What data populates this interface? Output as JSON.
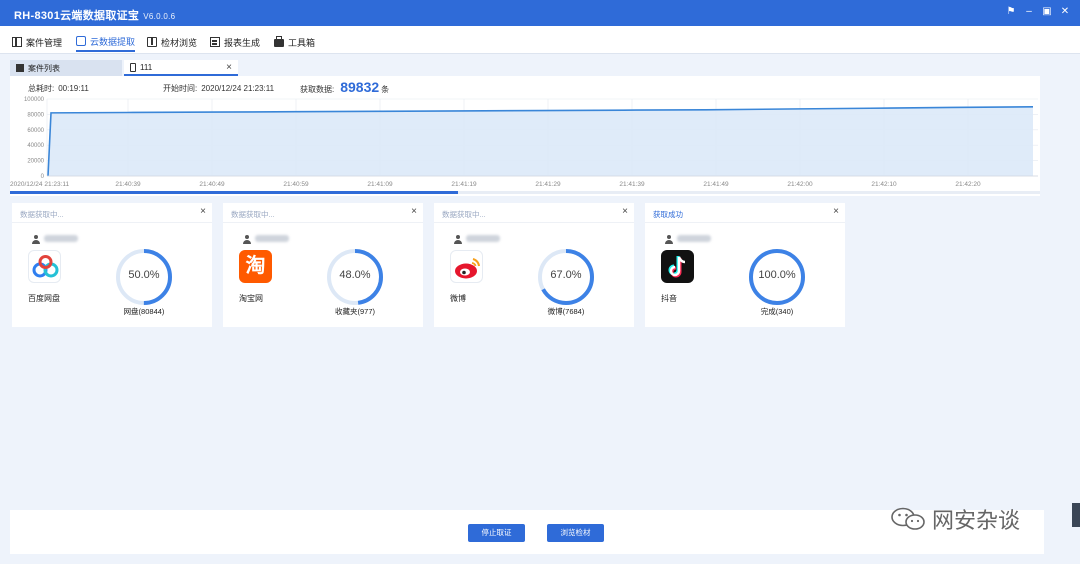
{
  "window": {
    "title": "RH-8301云端数据取证宝",
    "version": "V6.0.0.6",
    "controls": [
      "⚑",
      "–",
      "▣",
      "✕"
    ]
  },
  "menu": {
    "items": [
      {
        "label": "案件管理",
        "icon": "grid-icon",
        "active": false
      },
      {
        "label": "云数据提取",
        "icon": "cloud-icon",
        "active": true
      },
      {
        "label": "检材浏览",
        "icon": "book-icon",
        "active": false
      },
      {
        "label": "报表生成",
        "icon": "report-icon",
        "active": false
      },
      {
        "label": "工具箱",
        "icon": "toolbox-icon",
        "active": false
      }
    ]
  },
  "tabs": [
    {
      "label": "案件列表",
      "icon": "list-icon"
    },
    {
      "label": "111",
      "icon": "phone-icon",
      "close": "×"
    }
  ],
  "stats": {
    "elapsed_label": "总耗时:",
    "elapsed_value": "00:19:11",
    "start_label": "开始时间:",
    "start_value": "2020/12/24 21:23:11",
    "count_label": "获取数据:",
    "count_value": "89832",
    "count_unit": "条"
  },
  "progress": 0.435,
  "chart_data": {
    "type": "area",
    "x": [
      "2020/12/24 21:23:11",
      "21:23:12",
      "21:40:39",
      "21:40:49",
      "21:40:59",
      "21:41:09",
      "21:41:19",
      "21:41:29",
      "21:41:39",
      "21:41:49",
      "21:42:00",
      "21:42:10",
      "21:42:20",
      "21:42:29"
    ],
    "y": [
      0,
      82000,
      82500,
      83000,
      83500,
      84000,
      84500,
      85000,
      85500,
      86000,
      87000,
      88000,
      89000,
      89832
    ],
    "xtick_labels": [
      "2020/12/24 21:23:11",
      "21:40:39",
      "21:40:49",
      "21:40:59",
      "21:41:09",
      "21:41:19",
      "21:41:29",
      "21:41:39",
      "21:41:49",
      "21:42:00",
      "21:42:10",
      "21:42:20"
    ],
    "ytick_labels": [
      "100000",
      "80000",
      "60000",
      "40000",
      "20000",
      "0"
    ],
    "ylim": [
      0,
      100000
    ],
    "grid": true,
    "line_color": "#3a86d8",
    "fill_color": "#dbe9f8"
  },
  "cards": [
    {
      "status": "数据获取中...",
      "app_name": "百度网盘",
      "logo": "baidu-netdisk-logo",
      "percent": 50.0,
      "percent_label": "50.0%",
      "caption": "网盘(80844)",
      "done": false
    },
    {
      "status": "数据获取中...",
      "app_name": "淘宝网",
      "logo": "taobao-logo",
      "logo_glyph": "淘",
      "percent": 48.0,
      "percent_label": "48.0%",
      "caption": "收藏夹(977)",
      "done": false
    },
    {
      "status": "数据获取中...",
      "app_name": "微博",
      "logo": "weibo-logo",
      "percent": 67.0,
      "percent_label": "67.0%",
      "caption": "微博(7684)",
      "done": false
    },
    {
      "status": "获取成功",
      "app_name": "抖音",
      "logo": "douyin-logo",
      "percent": 100.0,
      "percent_label": "100.0%",
      "caption": "完成(340)",
      "done": true
    }
  ],
  "buttons": {
    "stop": "停止取证",
    "browse": "浏览检材"
  },
  "watermark": "网安杂谈",
  "colors": {
    "accent": "#2f6bd8",
    "ring": "#3d82e6",
    "ring_track": "#dde8f6"
  }
}
